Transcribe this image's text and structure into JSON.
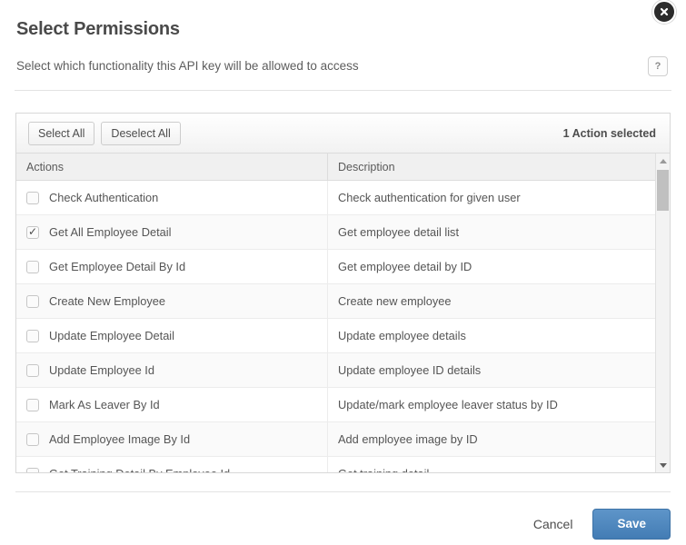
{
  "dialog": {
    "title": "Select Permissions",
    "subtitle": "Select which functionality this API key will be allowed to access",
    "help_label": "?",
    "close_label": "×"
  },
  "toolbar": {
    "select_all_label": "Select All",
    "deselect_all_label": "Deselect All",
    "selected_count": "1 Action selected"
  },
  "table": {
    "headers": {
      "actions": "Actions",
      "description": "Description"
    },
    "rows": [
      {
        "action": "Check Authentication",
        "description": "Check authentication for given user",
        "checked": false
      },
      {
        "action": "Get All Employee Detail",
        "description": "Get employee detail list",
        "checked": true
      },
      {
        "action": "Get Employee Detail By Id",
        "description": "Get employee detail by ID",
        "checked": false
      },
      {
        "action": "Create New Employee",
        "description": "Create new employee",
        "checked": false
      },
      {
        "action": "Update Employee Detail",
        "description": "Update employee details",
        "checked": false
      },
      {
        "action": "Update Employee Id",
        "description": "Update employee ID details",
        "checked": false
      },
      {
        "action": "Mark As Leaver By Id",
        "description": "Update/mark employee leaver status by ID",
        "checked": false
      },
      {
        "action": "Add Employee Image By Id",
        "description": "Add employee image by ID",
        "checked": false
      },
      {
        "action": "Get Training Detail By Employee Id",
        "description": "Get training detail",
        "checked": false
      }
    ]
  },
  "scrollbar": {
    "up_arrow": "up-arrow",
    "down_arrow": "down-arrow"
  },
  "footer": {
    "cancel_label": "Cancel",
    "save_label": "Save"
  },
  "colors": {
    "accent": "#437cb4",
    "close_bg": "#2b2b2b",
    "text": "#555555",
    "panel_border": "#d8d8d8",
    "row_alt": "#fafafa"
  }
}
